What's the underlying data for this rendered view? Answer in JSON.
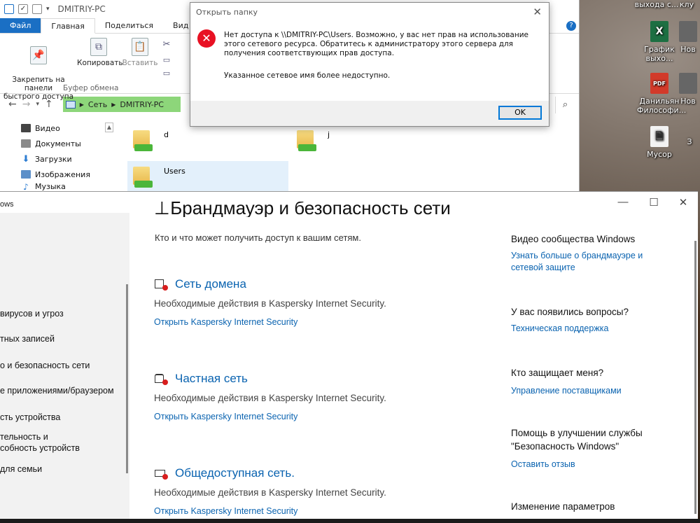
{
  "desktop": {
    "icons": [
      {
        "label": "выхода с...",
        "glyph": "",
        "color": "#444444"
      },
      {
        "label": "клу",
        "glyph": "",
        "color": "#444444"
      },
      {
        "label": "График\nвыхо...",
        "glyph": "X",
        "color": "#1d6f42"
      },
      {
        "label": "Нов",
        "glyph": "",
        "color": "#666666"
      },
      {
        "label": "Данильян\nФилософи...",
        "glyph": "PDF",
        "color": "#d23a2a"
      },
      {
        "label": "Нов",
        "glyph": "",
        "color": "#666666"
      },
      {
        "label": "Мусор",
        "glyph": "🗎",
        "color": "#777777"
      },
      {
        "label": "З",
        "glyph": "",
        "color": "#666666"
      }
    ]
  },
  "explorer": {
    "title": "DMITRIY-PC",
    "tabs": [
      "Файл",
      "Главная",
      "Поделиться",
      "Вид"
    ],
    "ribbon": {
      "pin_label": "Закрепить на панели\nбыстрого доступа",
      "copy_label": "Копировать",
      "paste_label": "Вставить",
      "group_label": "Буфер обмена"
    },
    "address": {
      "crumb1": "Сеть",
      "crumb2": "DMITRIY-PC"
    },
    "nav_items": [
      {
        "label": "Видео",
        "color": "#444444"
      },
      {
        "label": "Документы",
        "color": "#8a8a8a"
      },
      {
        "label": "Загрузки",
        "color": "#2d7dd2"
      },
      {
        "label": "Изображения",
        "color": "#5b8fc9"
      },
      {
        "label": "Музыка",
        "color": "#2d7dd2"
      }
    ],
    "folders": [
      {
        "name": "d"
      },
      {
        "name": "j"
      },
      {
        "name": "Users"
      }
    ]
  },
  "dialog": {
    "title": "Открыть папку",
    "message": "Нет доступа к \\\\DMITRIY-PC\\Users. Возможно, у вас нет прав на использование этого сетевого ресурса. Обратитесь к администратору этого сервера для получения соответствующих прав доступа.",
    "message2": "Указанное сетевое имя более недоступно.",
    "ok_label": "OK"
  },
  "security": {
    "app_name": "ows",
    "page_title": "Брандмауэр и безопасность сети",
    "subtitle": "Кто и что может получить доступ к вашим сетям.",
    "sidebar_items": [
      "вирусов и угроз",
      "тных записей",
      "о и безопасность сети",
      "е приложениями/браузером",
      "сть устройства",
      "тельность и\nсобность устройств",
      "для семьи"
    ],
    "networks": [
      {
        "title": "Сеть домена",
        "desc": "Необходимые действия в Kaspersky Internet Security.",
        "link": "Открыть Kaspersky Internet Security"
      },
      {
        "title": "Частная сеть",
        "desc": "Необходимые действия в Kaspersky Internet Security.",
        "link": "Открыть Kaspersky Internet Security"
      },
      {
        "title": "Общедоступная сеть.",
        "desc": "Необходимые действия в Kaspersky Internet Security.",
        "link": "Открыть Kaspersky Internet Security"
      }
    ],
    "right": [
      {
        "head": "Видео сообщества Windows",
        "link": "Узнать больше о брандмауэре и сетевой защите"
      },
      {
        "head": "У вас появились вопросы?",
        "link": "Техническая поддержка"
      },
      {
        "head": "Кто защищает меня?",
        "link": "Управление поставщиками"
      },
      {
        "head": "Помощь в улучшении службы\n\"Безопасность Windows\"",
        "link": "Оставить отзыв"
      },
      {
        "head": "Изменение параметров",
        "link": ""
      }
    ]
  }
}
